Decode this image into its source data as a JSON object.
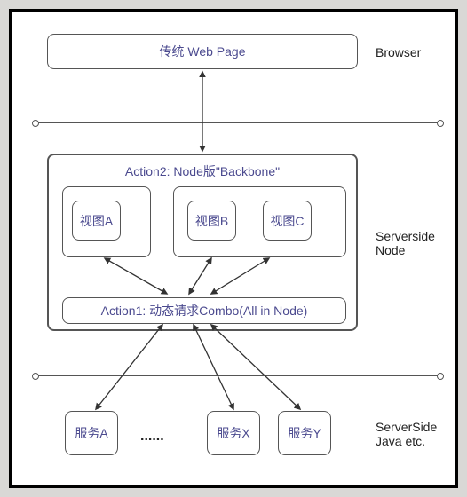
{
  "browser": {
    "webpage": "传统 Web Page",
    "label": "Browser"
  },
  "node": {
    "action2": "Action2: Node版\"Backbone\"",
    "viewA": "视图A",
    "viewB": "视图B",
    "viewC": "视图C",
    "action1": "Action1: 动态请求Combo(All in Node)",
    "label": "Serverside\nNode"
  },
  "java": {
    "serviceA": "服务A",
    "dots": "......",
    "serviceX": "服务X",
    "serviceY": "服务Y",
    "label": "ServerSide\nJava etc."
  }
}
